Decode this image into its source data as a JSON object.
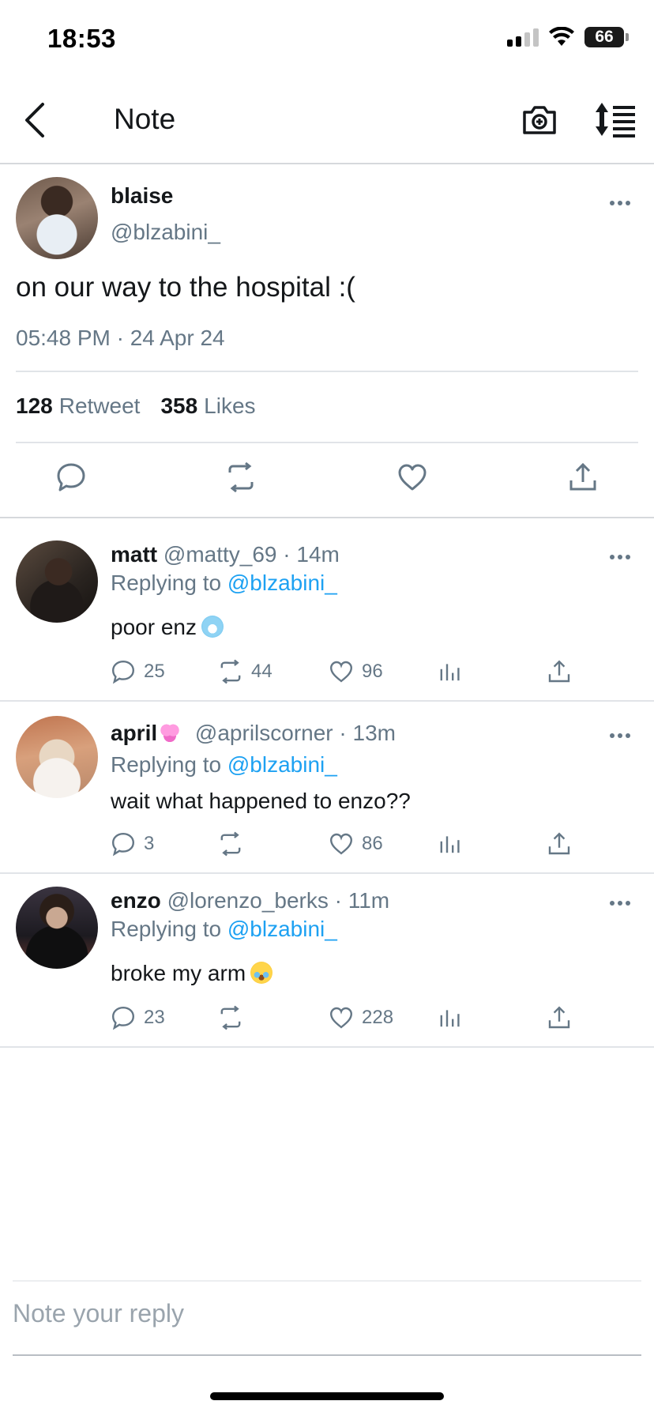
{
  "status_bar": {
    "time": "18:53",
    "battery": "66"
  },
  "nav": {
    "title": "Note"
  },
  "main_post": {
    "name": "blaise",
    "handle": "@blzabini_",
    "text": "on our way to the hospital :(",
    "timestamp": "05:48 PM · 24 Apr 24",
    "retweets": "128",
    "retweets_label": "Retweet",
    "likes": "358",
    "likes_label": "Likes"
  },
  "replies": [
    {
      "name": "matt",
      "meta": "@matty_69 · 14m",
      "replying_prefix": "Replying to",
      "replying_handle": "@blzabini_",
      "text": "poor enz",
      "emoji": "cold-face-emoji",
      "comments": "25",
      "retweets": "44",
      "likes": "96"
    },
    {
      "name": "april",
      "name_emoji": "heart-emoji",
      "meta": "@aprilscorner · 13m",
      "replying_prefix": "Replying to",
      "replying_handle": "@blzabini_",
      "text": "wait what happened to enzo??",
      "comments": "3",
      "retweets": "",
      "likes": "86"
    },
    {
      "name": "enzo",
      "meta": "@lorenzo_berks · 11m",
      "replying_prefix": "Replying to",
      "replying_handle": "@blzabini_",
      "text": "broke my arm",
      "emoji": "crying-face-emoji",
      "comments": "23",
      "retweets": "",
      "likes": "228"
    }
  ],
  "composer": {
    "placeholder": "Note your reply"
  },
  "colors": {
    "accent": "#1da1f2",
    "secondary_text": "#657786",
    "primary_text": "#14171a"
  }
}
